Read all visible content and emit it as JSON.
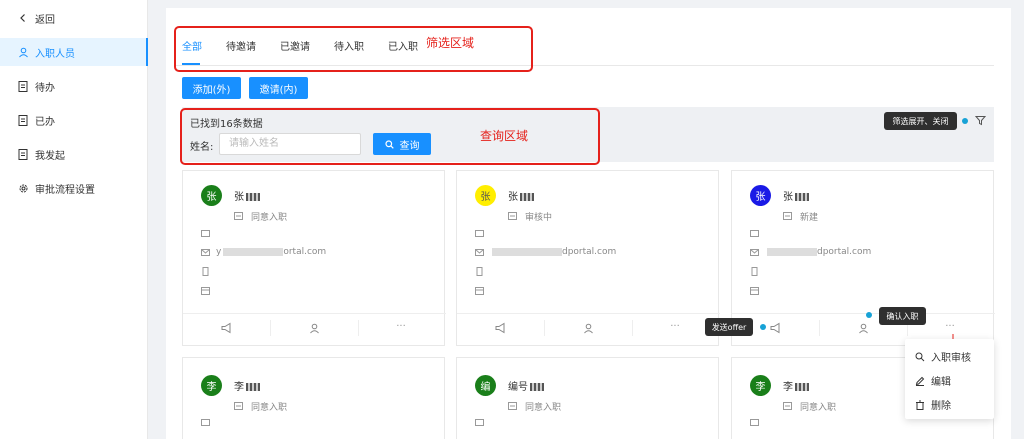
{
  "sidebar": {
    "back": "返回",
    "items": [
      {
        "label": "入职人员",
        "active": true
      },
      {
        "label": "待办"
      },
      {
        "label": "已办"
      },
      {
        "label": "我发起"
      },
      {
        "label": "审批流程设置"
      }
    ]
  },
  "tabs": [
    "全部",
    "待邀请",
    "已邀请",
    "待入职",
    "已入职"
  ],
  "annotations": {
    "filter_area": "筛选区域",
    "query_area": "查询区域"
  },
  "buttons": {
    "add": "添加(外)",
    "invite": "邀请(内)",
    "query": "查询"
  },
  "search": {
    "found_text": "已找到16条数据",
    "name_label": "姓名:",
    "name_placeholder": "请输入姓名"
  },
  "tooltips": {
    "filter_toggle": "筛选展开、关闭",
    "send_offer": "发送offer",
    "confirm_onboard": "确认入职"
  },
  "cards": [
    {
      "avatar": "张",
      "avatar_color": "#1a7f1a",
      "name": "张",
      "status": "同意入职",
      "email_prefix": "y",
      "email_suffix": "ortal.com"
    },
    {
      "avatar": "张",
      "avatar_color": "#ffee00",
      "name": "张",
      "status": "审核中",
      "email_prefix": "",
      "email_suffix": "dportal.com"
    },
    {
      "avatar": "张",
      "avatar_color": "#1a1ae6",
      "name": "张",
      "status": "新建",
      "email_prefix": "",
      "email_suffix": "dportal.com"
    },
    {
      "avatar": "李",
      "avatar_color": "#1a7f1a",
      "name": "李",
      "status": "同意入职"
    },
    {
      "avatar": "编",
      "avatar_color": "#1a7f1a",
      "name": "编号",
      "status": "同意入职"
    },
    {
      "avatar": "李",
      "avatar_color": "#1a7f1a",
      "name": "李",
      "status": "同意入职"
    }
  ],
  "dropdown": [
    "入职审核",
    "编辑",
    "删除"
  ],
  "colors": {
    "primary": "#1890ff",
    "annotation": "#e5211b"
  }
}
